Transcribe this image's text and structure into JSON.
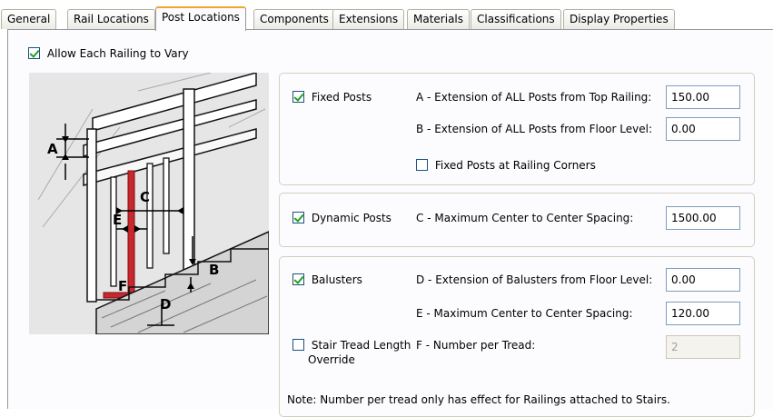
{
  "tabs": [
    {
      "label": "General",
      "active": false
    },
    {
      "label": "Rail Locations",
      "active": false
    },
    {
      "label": "Post Locations",
      "active": true
    },
    {
      "label": "Components",
      "active": false
    },
    {
      "label": "Extensions",
      "active": false
    },
    {
      "label": "Materials",
      "active": false
    },
    {
      "label": "Classifications",
      "active": false
    },
    {
      "label": "Display Properties",
      "active": false
    }
  ],
  "allow_vary": {
    "label": "Allow Each Railing to Vary",
    "checked": true
  },
  "illustration_labels": {
    "A": "A",
    "B": "B",
    "C": "C",
    "D": "D",
    "E": "E",
    "F": "F"
  },
  "fixed_posts": {
    "checkbox_label": "Fixed Posts",
    "checked": true,
    "extension_top_label": "A - Extension of ALL Posts from Top Railing:",
    "extension_top_value": "150.00",
    "extension_floor_label": "B - Extension of ALL Posts from Floor Level:",
    "extension_floor_value": "0.00",
    "corners_label": "Fixed Posts at Railing Corners",
    "corners_checked": false
  },
  "dynamic_posts": {
    "checkbox_label": "Dynamic Posts",
    "checked": true,
    "spacing_label": "C - Maximum Center to Center Spacing:",
    "spacing_value": "1500.00"
  },
  "balusters": {
    "checkbox_label": "Balusters",
    "checked": true,
    "extension_label": "D - Extension of Balusters from Floor Level:",
    "extension_value": "0.00",
    "spacing_label": "E - Maximum Center to Center Spacing:",
    "spacing_value": "120.00",
    "tread_override_label_line1": "Stair Tread Length",
    "tread_override_label_line2": "Override",
    "tread_override_checked": false,
    "per_tread_label": "F - Number per Tread:",
    "per_tread_value": "2"
  },
  "note": "Note: Number per tread only has effect for Railings attached to Stairs.",
  "colors": {
    "tab_accent": "#f4a232",
    "check_mark": "#21a121",
    "baluster_highlight": "#c8282d"
  }
}
